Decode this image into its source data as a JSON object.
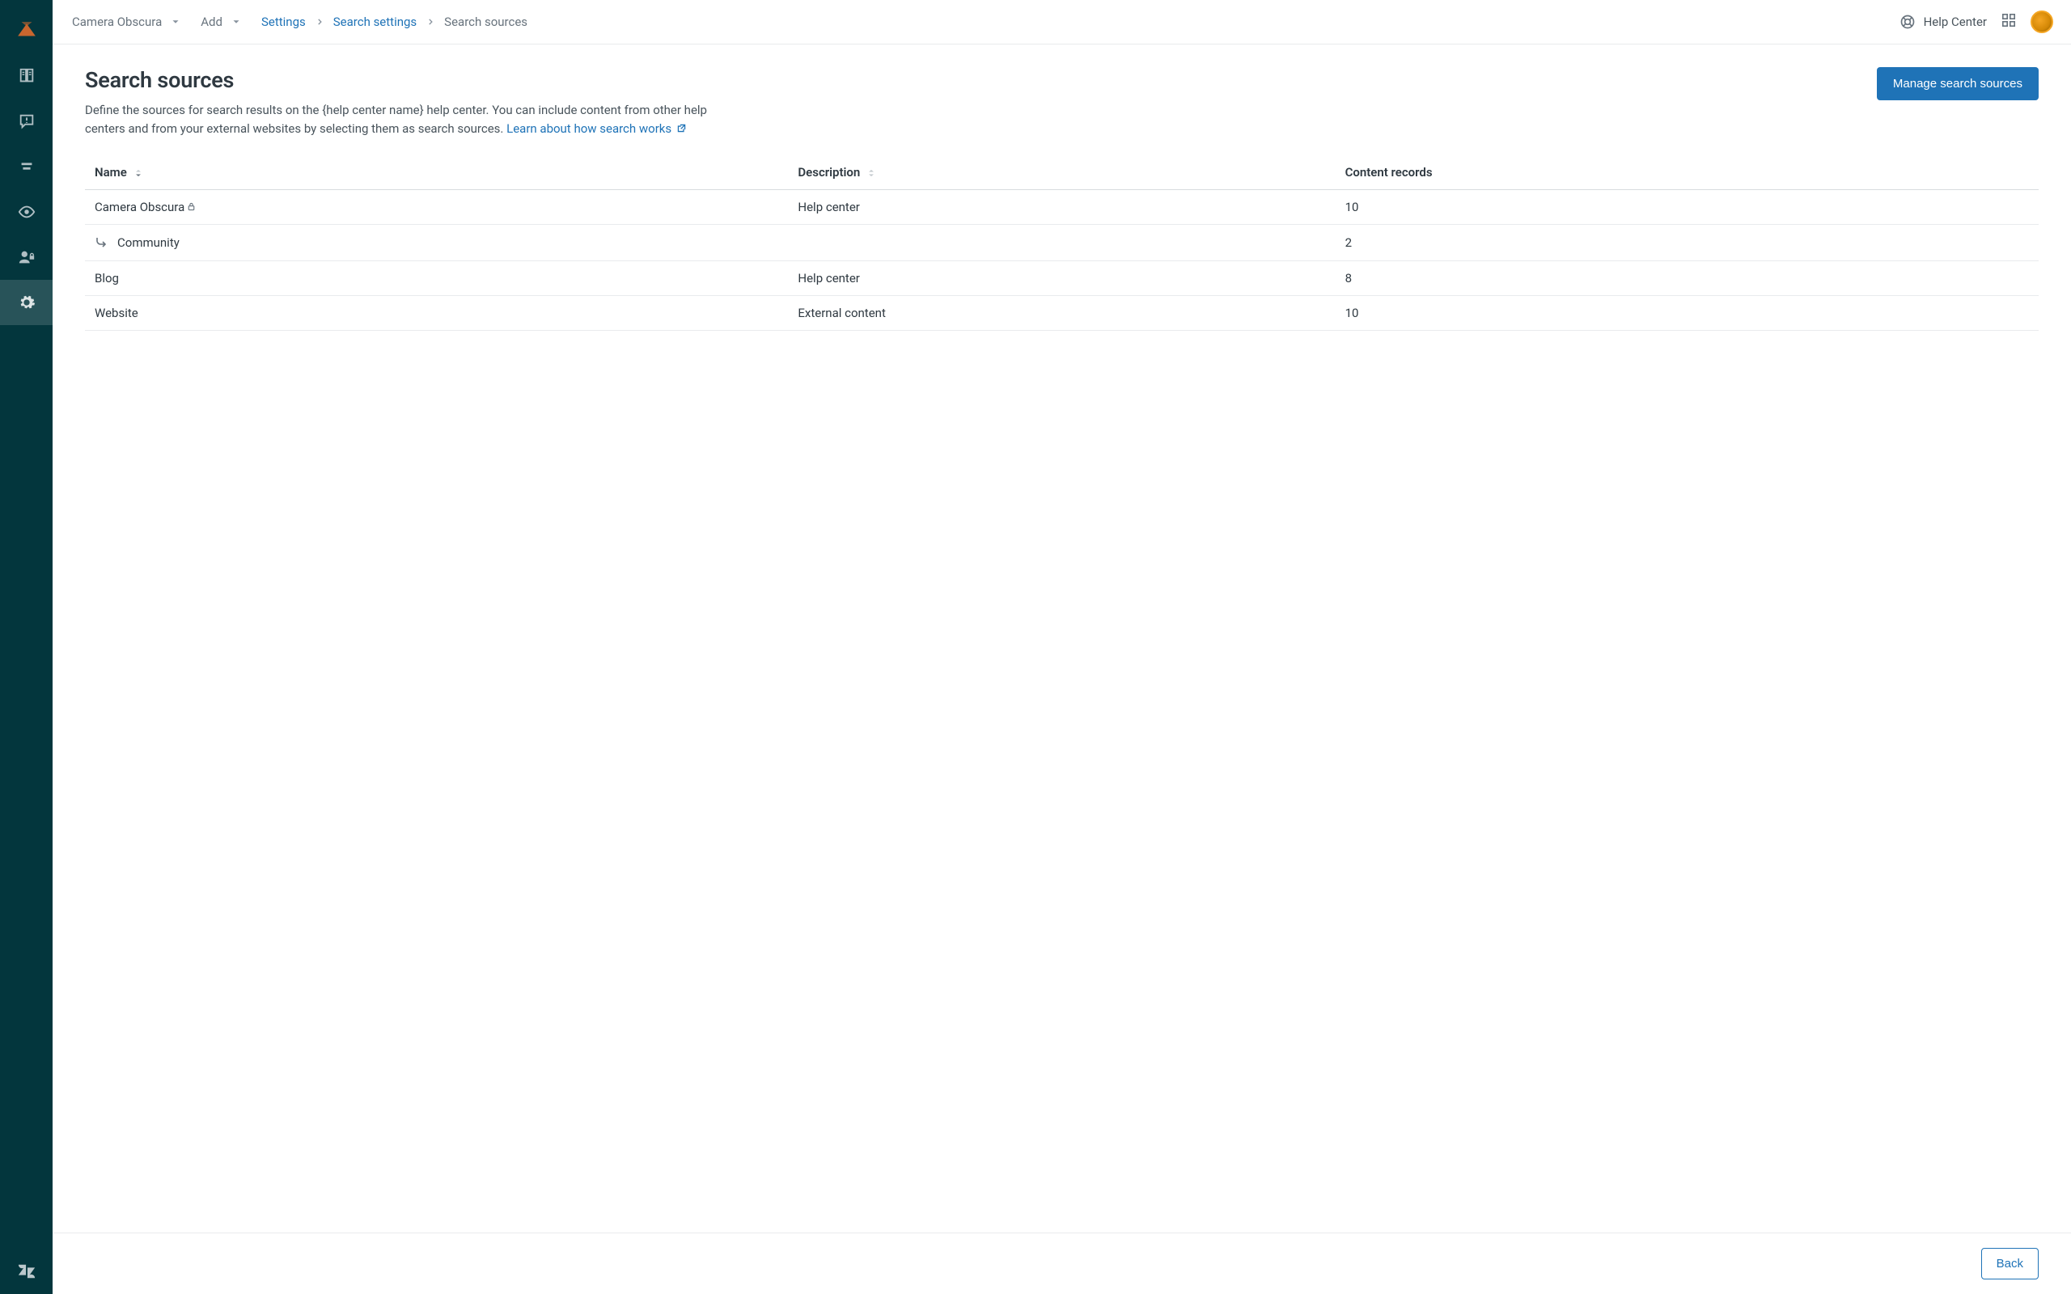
{
  "topbar": {
    "workspace_dropdown": "Camera Obscura",
    "add_dropdown": "Add",
    "help_center_link": "Help Center"
  },
  "breadcrumb": {
    "settings": "Settings",
    "search_settings": "Search settings",
    "current": "Search sources"
  },
  "page": {
    "title": "Search sources",
    "description": "Define the sources for search results on the {help center name} help center. You can include content from other help centers and from your external websites by selecting them as search sources.",
    "learn_link": "Learn about how search works",
    "manage_button": "Manage search sources",
    "back_button": "Back"
  },
  "table": {
    "headers": {
      "name": "Name",
      "description": "Description",
      "records": "Content records"
    },
    "rows": [
      {
        "name": "Camera Obscura",
        "locked": true,
        "description": "Help center",
        "records": "10",
        "child": false
      },
      {
        "name": "Community",
        "locked": false,
        "description": "",
        "records": "2",
        "child": true
      },
      {
        "name": "Blog",
        "locked": false,
        "description": "Help center",
        "records": "8",
        "child": false
      },
      {
        "name": "Website",
        "locked": false,
        "description": "External content",
        "records": "10",
        "child": false
      }
    ]
  }
}
